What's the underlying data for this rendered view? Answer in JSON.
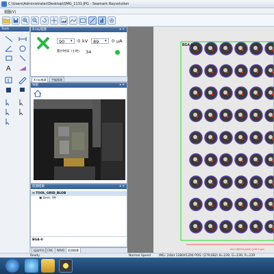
{
  "window": {
    "title": "C:\\Users\\Administrator\\Desktop\\QMG_1131.JPG - Seamark Rayvolution"
  },
  "menu": {
    "label": "视图(V)"
  },
  "tools_panel": {
    "title": "Tools"
  },
  "xray": {
    "title": "X-ray电源",
    "kv_value": "90",
    "kv_reading": "0",
    "kv_unit": "kV",
    "ua_value": "89",
    "ua_reading": "0",
    "ua_unit": "μA",
    "time_label": "累计时间（小时）",
    "time_value": "34",
    "status_color": "#22c33a"
  },
  "xray_tabs": [
    "X-ray电源",
    "平板探测"
  ],
  "navigation": {
    "title": "导航"
  },
  "result": {
    "title": "检测结果",
    "tree_root": "TOOL_GRID_BLOB",
    "tree_child": "Item: 99",
    "footer": "BGA-0"
  },
  "bottom_tabs": [
    "运动平台",
    "CNC",
    "NAVO",
    "检测结果"
  ],
  "mainview": {
    "roi_label": "BGA-0",
    "measure": "mm 1892.6 pixel) (118.2 μm",
    "grid_rows": 9,
    "grid_cols": 6
  },
  "status": {
    "ready": "Ready",
    "speed": "Normal Speed",
    "info": "IMG: 24bit 1280X1200  POS: (279,682) B=239, G=239, R=239"
  },
  "colors": {
    "accent": "#355e93",
    "roi": "#22dd22",
    "measure": "#ff3030"
  }
}
